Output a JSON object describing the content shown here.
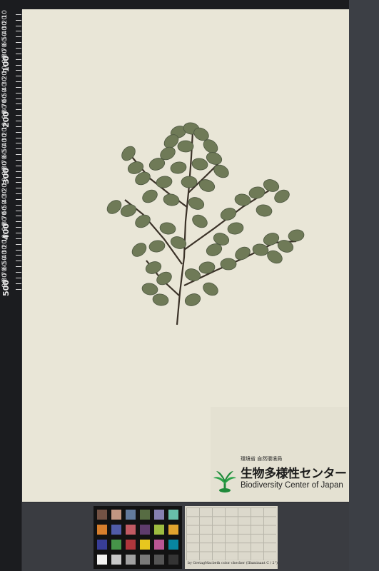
{
  "ruler": {
    "major_labels": [
      "100",
      "200",
      "300",
      "400",
      "500"
    ],
    "minor_labels": [
      "10",
      "20",
      "30",
      "40",
      "50",
      "60",
      "70",
      "80",
      "90",
      "10",
      "20",
      "30",
      "40",
      "50",
      "60",
      "70",
      "80",
      "90",
      "10",
      "20",
      "30",
      "40",
      "50",
      "60",
      "70",
      "80",
      "90",
      "10",
      "20",
      "30",
      "40",
      "50",
      "60",
      "70",
      "80",
      "90",
      "10",
      "20",
      "30",
      "40",
      "50",
      "60",
      "70",
      "80",
      "90"
    ]
  },
  "label": {
    "agency": "環境省 自然環境局",
    "title_jp": "生物多様性センター",
    "title_en": "Biodiversity Center of Japan"
  },
  "color_checker": {
    "swatches": [
      "#735244",
      "#c29682",
      "#627a9d",
      "#576c43",
      "#8580b1",
      "#67bdaa",
      "#d67e2c",
      "#505ba6",
      "#c15a63",
      "#5e3c6c",
      "#9dbc40",
      "#e0a32e",
      "#383d96",
      "#469449",
      "#af363c",
      "#e7c71f",
      "#bb5695",
      "#0885a1",
      "#f3f3f2",
      "#c8c8c8",
      "#a0a0a0",
      "#7a7a79",
      "#555555",
      "#343434"
    ],
    "caption": "by GretagMacbeth color checker (Illuminant C / 2°)"
  },
  "colors": {
    "sheet": "#e9e6d7",
    "leaf": "#6f7a57",
    "stem": "#3b3228"
  }
}
